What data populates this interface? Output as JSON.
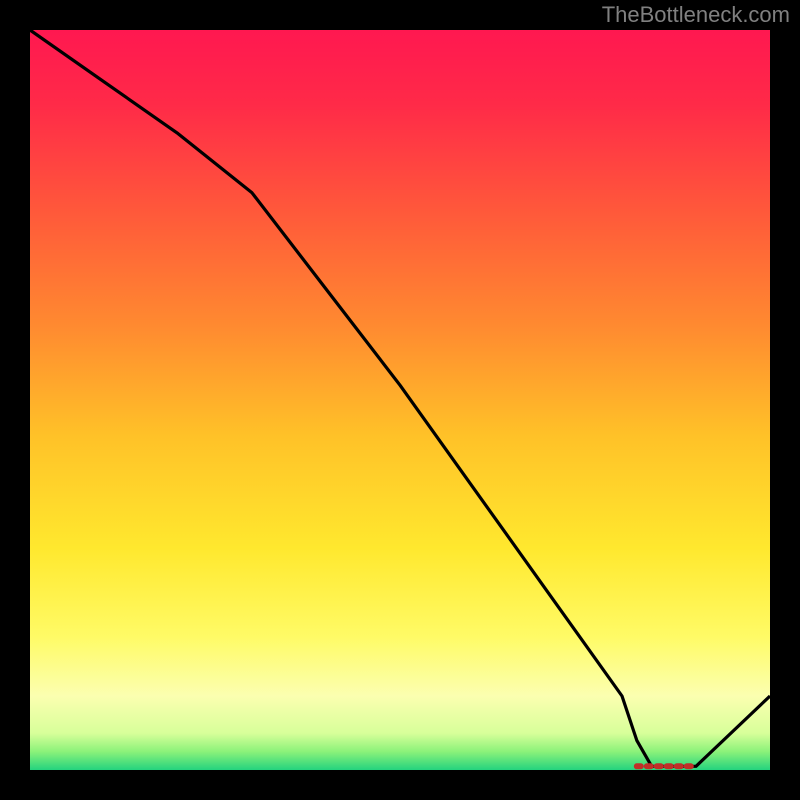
{
  "watermark": "TheBottleneck.com",
  "chart_data": {
    "type": "line",
    "title": "",
    "xlabel": "",
    "ylabel": "",
    "xlim": [
      0,
      100
    ],
    "ylim": [
      0,
      100
    ],
    "series": [
      {
        "name": "curve",
        "x": [
          0,
          10,
          20,
          30,
          40,
          50,
          60,
          70,
          80,
          82,
          84,
          86,
          88,
          90,
          100
        ],
        "y": [
          100,
          93,
          86,
          78,
          65,
          52,
          38,
          24,
          10,
          4,
          0.5,
          0.5,
          0.5,
          0.5,
          10
        ]
      }
    ],
    "flat_region": {
      "x_start": 82,
      "x_end": 90,
      "y": 0.5
    },
    "gradient_stops": [
      {
        "offset": 0.0,
        "color": "#ff1850"
      },
      {
        "offset": 0.1,
        "color": "#ff2a48"
      },
      {
        "offset": 0.25,
        "color": "#ff5a3a"
      },
      {
        "offset": 0.4,
        "color": "#ff8a30"
      },
      {
        "offset": 0.55,
        "color": "#ffc228"
      },
      {
        "offset": 0.7,
        "color": "#ffe82e"
      },
      {
        "offset": 0.82,
        "color": "#fffb66"
      },
      {
        "offset": 0.9,
        "color": "#fbffb0"
      },
      {
        "offset": 0.95,
        "color": "#d8ff9a"
      },
      {
        "offset": 0.975,
        "color": "#8cf27a"
      },
      {
        "offset": 1.0,
        "color": "#24d37e"
      }
    ]
  }
}
